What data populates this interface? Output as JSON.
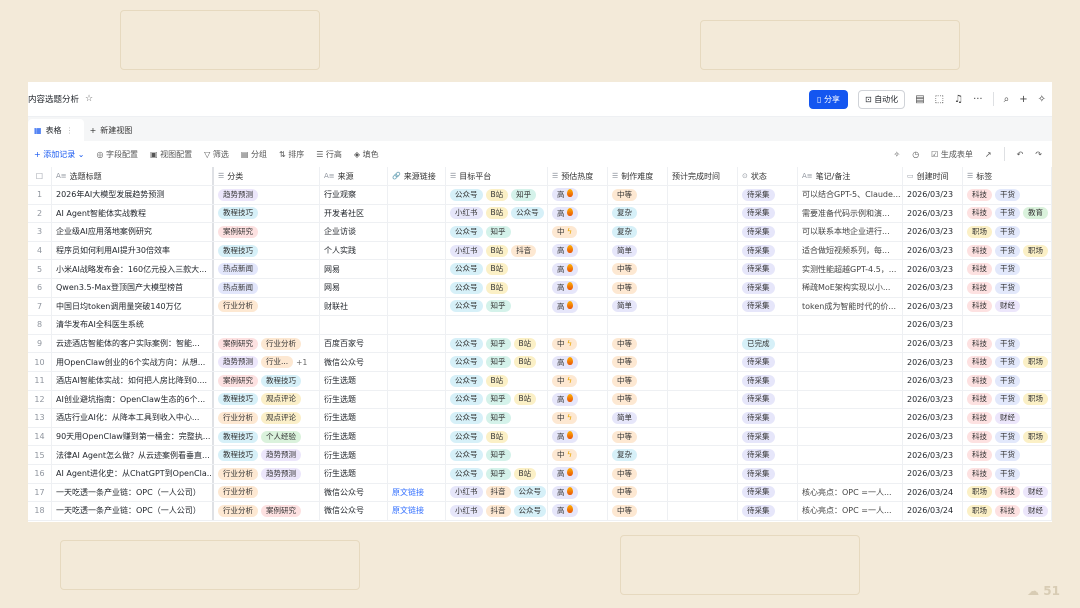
{
  "app": {
    "title": "内容选题分析",
    "share": "分享",
    "automation": "自动化"
  },
  "tabs": [
    {
      "label": "表格"
    },
    {
      "label": "新建视图"
    }
  ],
  "toolbar": {
    "add": "添加记录",
    "field_config": "字段配置",
    "view_config": "视图配置",
    "filter": "筛选",
    "group": "分组",
    "sort": "排序",
    "row_height": "行高",
    "color": "填色",
    "generate_form": "生成表单"
  },
  "columns": [
    "选题标题",
    "分类",
    "来源",
    "来源链接",
    "目标平台",
    "预估热度",
    "制作难度",
    "预计完成时间",
    "状态",
    "笔记/备注",
    "创建时间",
    "标签"
  ],
  "colors": {
    "趋势预测": "#ece6fb",
    "教程技巧": "#d6f0f8",
    "案例研究": "#fde1e1",
    "热点新闻": "#e2e6fb",
    "行业分析": "#fde8d2",
    "观点评论": "#fbefc8",
    "个人经验": "#daf2dc",
    "行业...": "#fde8d2",
    "公众号": "#d6f0f8",
    "B站": "#fbf0c6",
    "知乎": "#d4f2ea",
    "小红书": "#e6e6fa",
    "抖音": "#fde8d2",
    "高": "#e6e6fa",
    "中": "#fde8d2",
    "中等": "#fde8d2",
    "复杂": "#d6f0f8",
    "简单": "#e6e6fa",
    "待采集": "#e6e6fa",
    "已完成": "#d6f0f8",
    "科技": "#fde1e1",
    "干货": "#e2e8fb",
    "教育": "#daf2dc",
    "职场": "#fbf0c6",
    "财经": "#ece6fb",
    "accent": "#1456f0"
  },
  "rows": [
    {
      "n": "1",
      "title": "2026年AI大模型发展趋势预测",
      "cat": [
        "趋势预测"
      ],
      "src": "行业观察",
      "link": "",
      "plat": [
        "公众号",
        "B站",
        "知乎"
      ],
      "heat": "高",
      "diff": "中等",
      "eta": "",
      "status": "待采集",
      "note": "可以结合GPT-5、Claude...",
      "date": "2026/03/23",
      "tags": [
        "科技",
        "干货"
      ]
    },
    {
      "n": "2",
      "title": "AI Agent智能体实战教程",
      "cat": [
        "教程技巧"
      ],
      "src": "开发者社区",
      "link": "",
      "plat": [
        "小红书",
        "B站",
        "公众号"
      ],
      "heat": "高",
      "diff": "复杂",
      "eta": "",
      "status": "待采集",
      "note": "需要准备代码示例和演...",
      "date": "2026/03/23",
      "tags": [
        "科技",
        "干货",
        "教育"
      ]
    },
    {
      "n": "3",
      "title": "企业级AI应用落地案例研究",
      "cat": [
        "案例研究"
      ],
      "src": "企业访谈",
      "link": "",
      "plat": [
        "公众号",
        "知乎"
      ],
      "heat": "中",
      "diff": "复杂",
      "eta": "",
      "status": "待采集",
      "note": "可以联系本地企业进行...",
      "date": "2026/03/23",
      "tags": [
        "职场",
        "干货"
      ]
    },
    {
      "n": "4",
      "title": "程序员如何利用AI提升30倍效率",
      "cat": [
        "教程技巧"
      ],
      "src": "个人实践",
      "link": "",
      "plat": [
        "小红书",
        "B站",
        "抖音"
      ],
      "heat": "高",
      "diff": "简单",
      "eta": "",
      "status": "待采集",
      "note": "适合做短视频系列，每...",
      "date": "2026/03/23",
      "tags": [
        "科技",
        "干货",
        "职场"
      ]
    },
    {
      "n": "5",
      "title": "小米AI战略发布会：160亿元投入三款大...",
      "cat": [
        "热点新闻"
      ],
      "src": "网易",
      "link": "",
      "plat": [
        "公众号",
        "B站"
      ],
      "heat": "高",
      "diff": "中等",
      "eta": "",
      "status": "待采集",
      "note": "实测性能超越GPT-4.5，...",
      "date": "2026/03/23",
      "tags": [
        "科技",
        "干货"
      ]
    },
    {
      "n": "6",
      "title": "Qwen3.5-Max登顶国产大模型榜首",
      "cat": [
        "热点新闻"
      ],
      "src": "网易",
      "link": "",
      "plat": [
        "公众号",
        "B站"
      ],
      "heat": "高",
      "diff": "中等",
      "eta": "",
      "status": "待采集",
      "note": "稀疏MoE架构实现以小...",
      "date": "2026/03/23",
      "tags": [
        "科技",
        "干货"
      ]
    },
    {
      "n": "7",
      "title": "中国日均token调用量突破140万亿",
      "cat": [
        "行业分析"
      ],
      "src": "财联社",
      "link": "",
      "plat": [
        "公众号",
        "知乎"
      ],
      "heat": "高",
      "diff": "简单",
      "eta": "",
      "status": "待采集",
      "note": "token成为智能时代的价...",
      "date": "2026/03/23",
      "tags": [
        "科技",
        "财经"
      ]
    },
    {
      "n": "8",
      "title": "清华发布AI全科医生系统",
      "cat": [],
      "src": "",
      "link": "",
      "plat": [],
      "heat": "",
      "diff": "",
      "eta": "",
      "status": "",
      "note": "",
      "date": "2026/03/23",
      "tags": []
    },
    {
      "n": "9",
      "title": "云迹酒店智能体的客户实际案例：智能...",
      "cat": [
        "案例研究",
        "行业分析"
      ],
      "src": "百度百家号",
      "link": "",
      "plat": [
        "公众号",
        "知乎",
        "B站"
      ],
      "heat": "中",
      "diff": "中等",
      "eta": "",
      "status": "已完成",
      "note": "",
      "date": "2026/03/23",
      "tags": [
        "科技",
        "干货"
      ]
    },
    {
      "n": "10",
      "title": "用OpenClaw创业的6个实战方向：从想...",
      "cat": [
        "趋势预测",
        "行业..."
      ],
      "more": "+1",
      "src": "微信公众号",
      "link": "",
      "plat": [
        "公众号",
        "知乎",
        "B站"
      ],
      "heat": "高",
      "diff": "中等",
      "eta": "",
      "status": "待采集",
      "note": "",
      "date": "2026/03/23",
      "tags": [
        "科技",
        "干货",
        "职场"
      ]
    },
    {
      "n": "11",
      "title": "酒店AI智能体实战：如何把人房比降到0....",
      "cat": [
        "案例研究",
        "教程技巧"
      ],
      "src": "衍生选题",
      "link": "",
      "plat": [
        "公众号",
        "B站"
      ],
      "heat": "中",
      "diff": "中等",
      "eta": "",
      "status": "待采集",
      "note": "",
      "date": "2026/03/23",
      "tags": [
        "科技",
        "干货"
      ]
    },
    {
      "n": "12",
      "title": "AI创业避坑指南：OpenClaw生态的6个...",
      "cat": [
        "教程技巧",
        "观点评论"
      ],
      "src": "衍生选题",
      "link": "",
      "plat": [
        "公众号",
        "知乎",
        "B站"
      ],
      "heat": "高",
      "diff": "中等",
      "eta": "",
      "status": "待采集",
      "note": "",
      "date": "2026/03/23",
      "tags": [
        "科技",
        "干货",
        "职场"
      ]
    },
    {
      "n": "13",
      "title": "酒店行业AI化：从降本工具到收入中心...",
      "cat": [
        "行业分析",
        "观点评论"
      ],
      "src": "衍生选题",
      "link": "",
      "plat": [
        "公众号",
        "知乎"
      ],
      "heat": "中",
      "diff": "简单",
      "eta": "",
      "status": "待采集",
      "note": "",
      "date": "2026/03/23",
      "tags": [
        "科技",
        "财经"
      ]
    },
    {
      "n": "14",
      "title": "90天用OpenClaw赚到第一桶金：完整执...",
      "cat": [
        "教程技巧",
        "个人经验"
      ],
      "src": "衍生选题",
      "link": "",
      "plat": [
        "公众号",
        "B站"
      ],
      "heat": "高",
      "diff": "中等",
      "eta": "",
      "status": "待采集",
      "note": "",
      "date": "2026/03/23",
      "tags": [
        "科技",
        "干货",
        "职场"
      ]
    },
    {
      "n": "15",
      "title": "法律AI Agent怎么做？从云迹案例看垂直...",
      "cat": [
        "教程技巧",
        "趋势预测"
      ],
      "src": "衍生选题",
      "link": "",
      "plat": [
        "公众号",
        "知乎"
      ],
      "heat": "中",
      "diff": "复杂",
      "eta": "",
      "status": "待采集",
      "note": "",
      "date": "2026/03/23",
      "tags": [
        "科技",
        "干货"
      ]
    },
    {
      "n": "16",
      "title": "AI Agent进化史：从ChatGPT到OpenCla...",
      "cat": [
        "行业分析",
        "趋势预测"
      ],
      "src": "衍生选题",
      "link": "",
      "plat": [
        "公众号",
        "知乎",
        "B站"
      ],
      "heat": "高",
      "diff": "中等",
      "eta": "",
      "status": "待采集",
      "note": "",
      "date": "2026/03/23",
      "tags": [
        "科技",
        "干货"
      ]
    },
    {
      "n": "17",
      "title": "一天吃透一条产业链：OPC（一人公司）",
      "cat": [
        "行业分析"
      ],
      "src": "微信公众号",
      "link": "原文链接",
      "plat": [
        "小红书",
        "抖音",
        "公众号"
      ],
      "heat": "高",
      "diff": "中等",
      "eta": "",
      "status": "待采集",
      "note": "核心亮点：OPC =一人...",
      "date": "2026/03/24",
      "tags": [
        "职场",
        "科技",
        "财经"
      ]
    },
    {
      "n": "18",
      "title": "一天吃透一条产业链：OPC（一人公司）",
      "cat": [
        "行业分析",
        "案例研究"
      ],
      "src": "微信公众号",
      "link": "原文链接",
      "plat": [
        "小红书",
        "抖音",
        "公众号"
      ],
      "heat": "高",
      "diff": "中等",
      "eta": "",
      "status": "待采集",
      "note": "核心亮点：OPC =一人...",
      "date": "2026/03/24",
      "tags": [
        "职场",
        "科技",
        "财经"
      ]
    }
  ]
}
